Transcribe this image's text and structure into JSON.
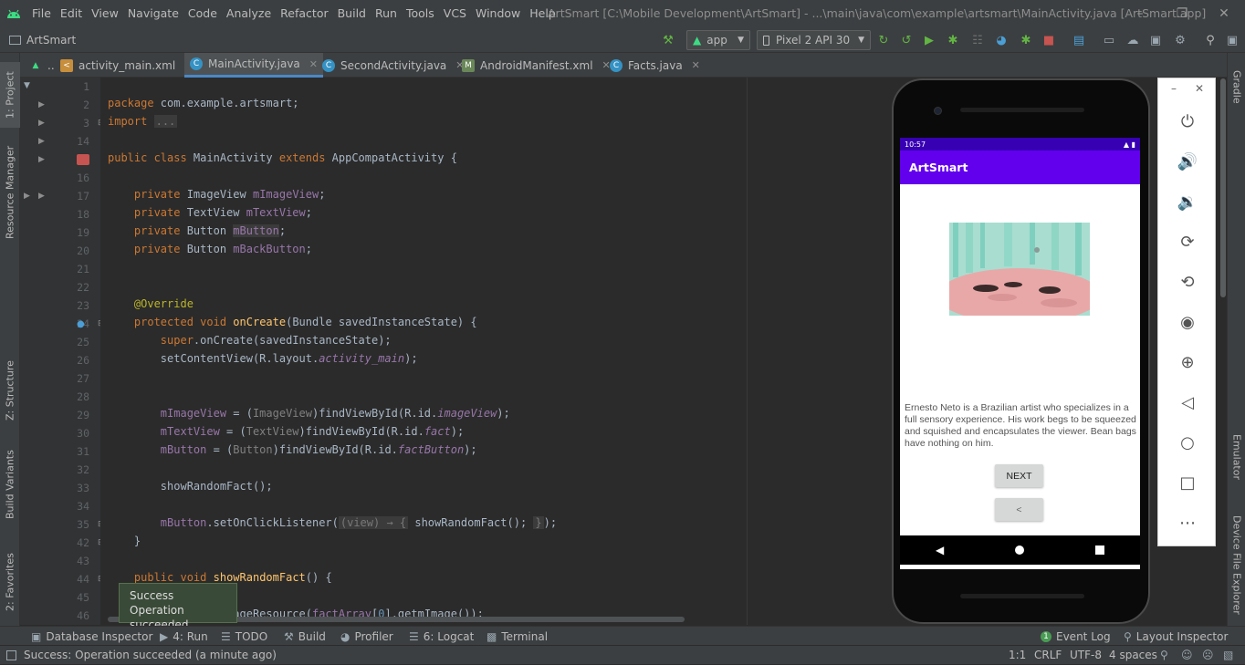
{
  "window": {
    "title": "ArtSmart [C:\\Mobile Development\\ArtSmart] - ...\\main\\java\\com\\example\\artsmart\\MainActivity.java [ArtSmart.app]",
    "menu": [
      "File",
      "Edit",
      "View",
      "Navigate",
      "Code",
      "Analyze",
      "Refactor",
      "Build",
      "Run",
      "Tools",
      "VCS",
      "Window",
      "Help"
    ]
  },
  "toolbar": {
    "project_name": "ArtSmart",
    "run_config": "app",
    "device": "Pixel 2 API 30"
  },
  "tabs": [
    {
      "label": "..",
      "icon": "android-icon"
    },
    {
      "label": "activity_main.xml",
      "icon": "xml-icon"
    },
    {
      "label": "MainActivity.java",
      "icon": "class-icon",
      "active": true
    },
    {
      "label": "SecondActivity.java",
      "icon": "class-icon"
    },
    {
      "label": "AndroidManifest.xml",
      "icon": "manifest-icon"
    },
    {
      "label": "Facts.java",
      "icon": "class-icon"
    }
  ],
  "left_tools": [
    "1: Project",
    "Resource Manager",
    "Z: Structure",
    "Build Variants",
    "2: Favorites"
  ],
  "right_tools": [
    "Gradle",
    "Emulator",
    "Device File Explorer"
  ],
  "editor": {
    "line_numbers": [
      "1",
      "2",
      "3",
      "14",
      "15",
      "16",
      "17",
      "18",
      "19",
      "20",
      "21",
      "22",
      "23",
      "24",
      "25",
      "26",
      "27",
      "28",
      "29",
      "30",
      "31",
      "32",
      "33",
      "34",
      "35",
      "42",
      "43",
      "44",
      "45",
      "46"
    ],
    "colors": {
      "keyword": "#cc7832",
      "field": "#9876aa",
      "method": "#ffc66d",
      "annotation": "#bbb529",
      "text": "#a9b7c6"
    }
  },
  "toast": {
    "title": "Success",
    "message": "Operation succeeded"
  },
  "emulator": {
    "status_time": "10:57",
    "app_title": "ArtSmart",
    "fact_text": "Ernesto Neto is a Brazilian artist who specializes in a full sensory experience. His work begs to be squeezed and squished and encapsulates the viewer. Bean bags have nothing on him.",
    "next_button": "NEXT",
    "back_button": "<",
    "app_bar_color": "#6200ee",
    "status_bar_color": "#3700b3"
  },
  "bottom_tools": {
    "database_inspector": "Database Inspector",
    "run": "4: Run",
    "todo": "TODO",
    "build": "Build",
    "profiler": "Profiler",
    "logcat": "6: Logcat",
    "terminal": "Terminal",
    "event_log": "Event Log",
    "event_log_count": "1",
    "layout_inspector": "Layout Inspector"
  },
  "status_bar": {
    "message": "Success: Operation succeeded (a minute ago)",
    "position": "1:1",
    "line_sep": "CRLF",
    "encoding": "UTF-8",
    "indent": "4 spaces"
  }
}
